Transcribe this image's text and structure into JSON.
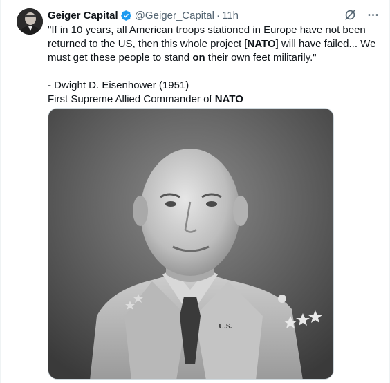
{
  "author": {
    "name": "Geiger Capital",
    "handle": "@Geiger_Capital",
    "separator": "·",
    "time": "11h",
    "verified": true
  },
  "tweet": {
    "quote_part1": "\"If in 10 years, all American troops stationed in Europe have not been returned to the US, then this whole project [",
    "quote_bold1": "NATO",
    "quote_part2": "] will have failed... We must get these people to stand ",
    "quote_bold2": "on",
    "quote_part3": " their own feet militarily.\"",
    "attribution": "- Dwight D. Eisenhower (1951)",
    "title_prefix": "First Supreme Allied Commander of ",
    "title_bold": "NATO"
  },
  "icons": {
    "grok": "grok-icon",
    "more": "more-icon",
    "verified": "verified-badge-icon"
  },
  "colors": {
    "verified": "#1d9bf0",
    "secondary_text": "#536471",
    "primary_text": "#0f1419"
  },
  "media": {
    "kind": "black-and-white portrait photograph of a man in military uniform",
    "uniform_text": "U.S."
  }
}
